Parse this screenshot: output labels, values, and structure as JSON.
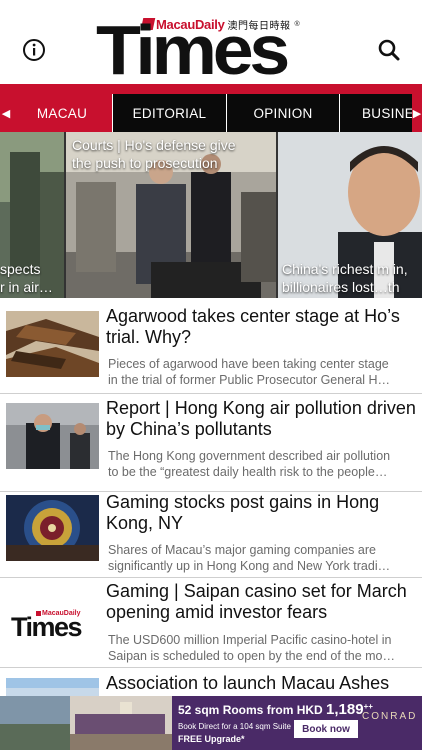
{
  "header": {
    "logo_daily": "MacauDaily",
    "logo_chinese": "澳門每日時報",
    "logo_times": "Times",
    "logo_reg": "®"
  },
  "tabs": [
    {
      "label": "MACAU",
      "active": true
    },
    {
      "label": "EDITORIAL",
      "active": false
    },
    {
      "label": "OPINION",
      "active": false
    },
    {
      "label": "BUSINES",
      "active": false
    }
  ],
  "carousel": {
    "left_caption": [
      "spects",
      "r in air…"
    ],
    "center_caption": [
      "Courts | Ho's defense give",
      "the push to prosecution"
    ],
    "right_caption": [
      "China's richest m in,",
      "billionaires lost…th"
    ]
  },
  "articles": [
    {
      "title": "Agarwood takes center stage at Ho’s trial. Why?",
      "summary": [
        "Pieces of agarwood have been taking center stage",
        "in the trial of former Public Prosecutor General H…"
      ]
    },
    {
      "title": "Report | Hong Kong air pollution driven by China’s pollutants",
      "summary": [
        "The Hong Kong government described air pollution",
        "to be the “greatest daily health risk to the people…"
      ]
    },
    {
      "title": "Gaming stocks post gains in Hong Kong, NY",
      "summary": [
        "Shares of Macau’s major gaming companies are",
        "significantly up in Hong Kong and New York tradi…"
      ]
    },
    {
      "title": "Gaming | Saipan casino set for March opening amid investor fears",
      "summary": [
        "The USD600 million Imperial Pacific casino-hotel in",
        "Saipan is scheduled to open by the end of the mo…"
      ],
      "thumb_logo_daily": "MacauDaily",
      "thumb_logo_times": "Times"
    },
    {
      "title": "Association to launch Macau Ashes",
      "summary": []
    }
  ],
  "ad": {
    "headline": "52 sqm Rooms from HKD",
    "price": "1,189",
    "price_suffix": "++",
    "line2": "Book Direct for a 104 sqm Suite",
    "line3": "FREE Upgrade*",
    "button": "Book now",
    "brand": "CONRAD",
    "colors": {
      "background": "#4a2a67"
    }
  },
  "colors": {
    "brand_red": "#c8102e",
    "tab_bar": "#0a0a0a",
    "summary_gray": "#6b6b6b"
  }
}
